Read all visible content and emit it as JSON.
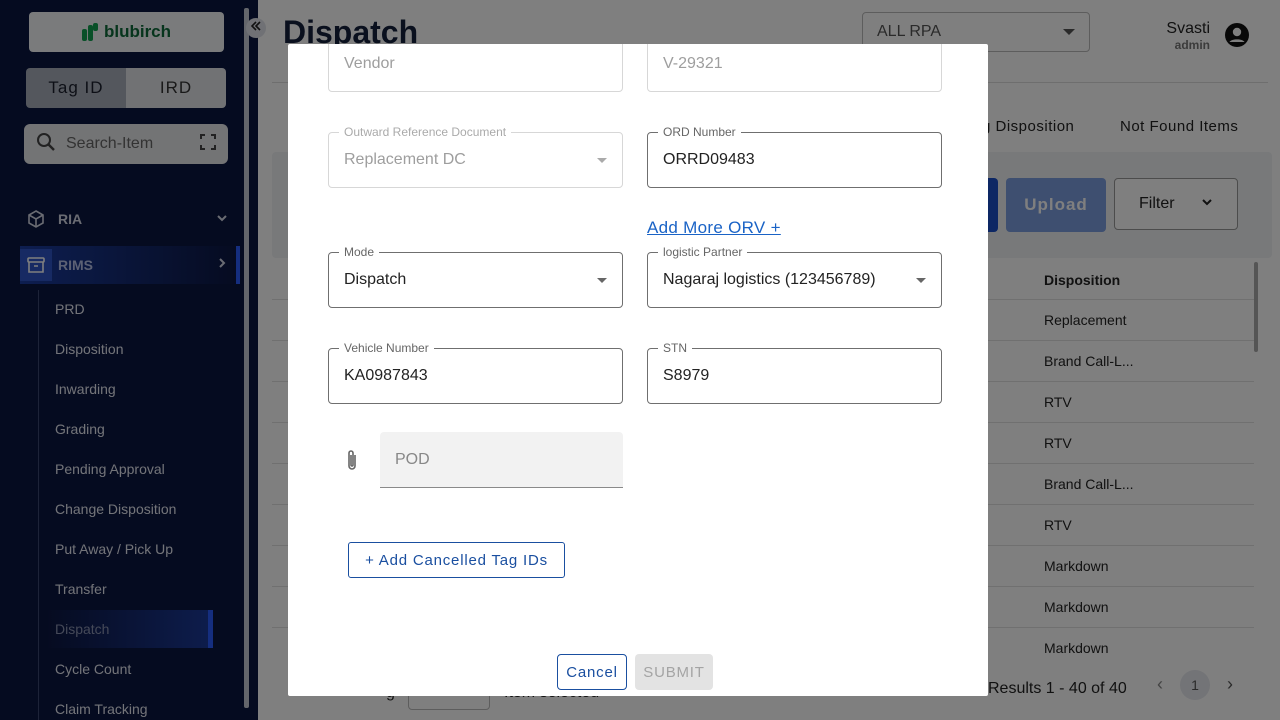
{
  "sidebar": {
    "logo_text": "blubirch",
    "toggle": {
      "active": "Tag ID",
      "inactive": "IRD"
    },
    "search_placeholder": "Search-Item",
    "groups": [
      {
        "label": "RIA",
        "icon": "cube-icon"
      },
      {
        "label": "RIMS",
        "icon": "archive-box-icon"
      }
    ],
    "items": [
      "PRD",
      "Disposition",
      "Inwarding",
      "Grading",
      "Pending Approval",
      "Change Disposition",
      "Put Away / Pick Up",
      "Transfer",
      "Dispatch",
      "Cycle Count",
      "Claim Tracking"
    ],
    "active_item": "Dispatch"
  },
  "header": {
    "title": "Dispatch",
    "rpa_select": "ALL RPA",
    "user_name": "Svasti",
    "user_role": "admin"
  },
  "tabs": [
    "g Disposition",
    "Not Found Items"
  ],
  "toolbar": {
    "upload_label": "Upload",
    "filter_label": "Filter"
  },
  "table": {
    "column": "Disposition",
    "rows": [
      "Replacement",
      "Brand Call-L...",
      "RTV",
      "RTV",
      "Brand Call-L...",
      "RTV",
      "Markdown",
      "Markdown",
      "Markdown"
    ]
  },
  "footer": {
    "left_label": "g",
    "selected_label": "Item selected",
    "results": "Results 1 - 40 of 40",
    "page": "1"
  },
  "modal": {
    "vendor_label": "Vendor",
    "vendor_value": "V-29321",
    "outward_label": "Outward Reference Document",
    "outward_value": "Replacement DC",
    "ord_label": "ORD Number",
    "ord_value": "ORRD09483",
    "add_more": "Add More ORV +",
    "mode_label": "Mode",
    "mode_value": "Dispatch",
    "logistic_label": "logistic Partner",
    "logistic_value": "Nagaraj logistics (123456789)",
    "vehicle_label": "Vehicle Number",
    "vehicle_value": "KA0987843",
    "stn_label": "STN",
    "stn_value": "S8979",
    "pod_placeholder": "POD",
    "add_cancelled": "+ Add Cancelled Tag IDs",
    "cancel": "Cancel",
    "submit": "SUBMIT"
  },
  "colors": {
    "sidebar_bg": "#0b1640",
    "accent": "#2a5cff",
    "primary": "#1a4fa0",
    "link": "#1a63c6"
  }
}
